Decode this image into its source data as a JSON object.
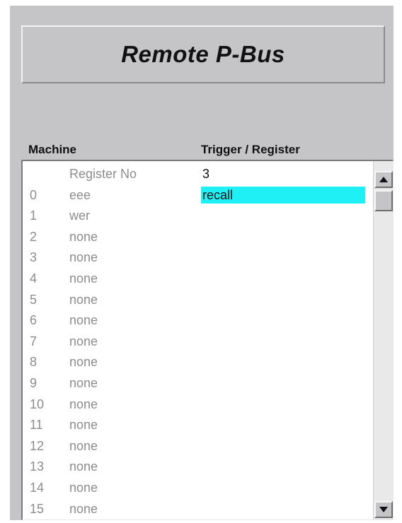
{
  "window": {
    "title": "Remote P-Bus"
  },
  "table": {
    "headers": {
      "machine": "Machine",
      "trigger": "Trigger / Register"
    },
    "rows": [
      {
        "num": "",
        "name": "Register No",
        "trigger": "3",
        "highlight": false
      },
      {
        "num": "0",
        "name": "eee",
        "trigger": "recall",
        "highlight": true
      },
      {
        "num": "1",
        "name": "wer",
        "trigger": "",
        "highlight": false
      },
      {
        "num": "2",
        "name": "none",
        "trigger": "",
        "highlight": false
      },
      {
        "num": "3",
        "name": "none",
        "trigger": "",
        "highlight": false
      },
      {
        "num": "4",
        "name": "none",
        "trigger": "",
        "highlight": false
      },
      {
        "num": "5",
        "name": "none",
        "trigger": "",
        "highlight": false
      },
      {
        "num": "6",
        "name": "none",
        "trigger": "",
        "highlight": false
      },
      {
        "num": "7",
        "name": "none",
        "trigger": "",
        "highlight": false
      },
      {
        "num": "8",
        "name": "none",
        "trigger": "",
        "highlight": false
      },
      {
        "num": "9",
        "name": "none",
        "trigger": "",
        "highlight": false
      },
      {
        "num": "10",
        "name": "none",
        "trigger": "",
        "highlight": false
      },
      {
        "num": "11",
        "name": "none",
        "trigger": "",
        "highlight": false
      },
      {
        "num": "12",
        "name": "none",
        "trigger": "",
        "highlight": false
      },
      {
        "num": "13",
        "name": "none",
        "trigger": "",
        "highlight": false
      },
      {
        "num": "14",
        "name": "none",
        "trigger": "",
        "highlight": false
      },
      {
        "num": "15",
        "name": "none",
        "trigger": "",
        "highlight": false
      }
    ]
  },
  "scrollbar": {
    "up_icon": "arrow-up-icon",
    "down_icon": "arrow-down-icon"
  },
  "colors": {
    "panel_background": "#c5c4c6",
    "selection_highlight": "#1ef0f5",
    "item_text": "#8c8c8c"
  }
}
